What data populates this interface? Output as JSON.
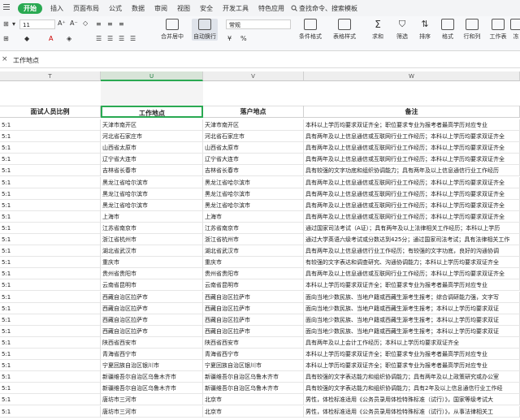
{
  "menubar": {
    "items": [
      "开始",
      "插入",
      "页面布局",
      "公式",
      "数据",
      "审阅",
      "视图",
      "安全",
      "开发工具",
      "特色应用"
    ],
    "search_label": "查找命令、搜索模板"
  },
  "ribbon": {
    "font_size": "11",
    "merge_label": "合并居中",
    "wrap_label": "自动换行",
    "number_format": "常规",
    "cond_format_label": "条件格式",
    "table_style_label": "表格样式",
    "sum_label": "求和",
    "filter_label": "筛选",
    "sort_label": "排序",
    "format_label": "格式",
    "rowcol_label": "行和列",
    "sheet_label": "工作表",
    "freeze_label": "冻"
  },
  "formula_bar": {
    "value": "工作地点"
  },
  "columns": [
    "T",
    "U",
    "V",
    "W"
  ],
  "header": [
    "面试人员比例",
    "工作地点",
    "落户地点",
    "备注"
  ],
  "rows": [
    [
      "5:1",
      "天津市南开区",
      "天津市南开区",
      "本科以上学历均要求双证齐全；职位要求专业为报考者最高学历对应专业"
    ],
    [
      "5:1",
      "河北省石家庄市",
      "河北省石家庄市",
      "具有两年及以上信息通信或互联网行业工作经历；本科以上学历均要求双证齐全"
    ],
    [
      "5:1",
      "山西省太原市",
      "山西省太原市",
      "具有两年及以上信息通信或互联网行业工作经历；本科以上学历均要求双证齐全"
    ],
    [
      "5:1",
      "辽宁省大连市",
      "辽宁省大连市",
      "具有两年及以上信息通信或互联网行业工作经历；本科以上学历均要求双证齐全"
    ],
    [
      "5:1",
      "吉林省长春市",
      "吉林省长春市",
      "具有较强的文字功底和组织协调能力；具有两年及以上信息通信行业工作经历"
    ],
    [
      "5:1",
      "黑龙江省哈尔滨市",
      "黑龙江省哈尔滨市",
      "具有两年及以上信息通信或互联网行业工作经历；本科以上学历均要求双证齐全"
    ],
    [
      "5:1",
      "黑龙江省哈尔滨市",
      "黑龙江省哈尔滨市",
      "具有两年及以上信息通信或互联网行业工作经历；本科以上学历均要求双证齐全"
    ],
    [
      "5:1",
      "黑龙江省哈尔滨市",
      "黑龙江省哈尔滨市",
      "具有两年及以上信息通信或互联网行业工作经历；本科以上学历均要求双证齐全"
    ],
    [
      "5:1",
      "上海市",
      "上海市",
      "具有两年及以上信息通信或互联网行业工作经历；本科以上学历均要求双证齐全"
    ],
    [
      "5:1",
      "江苏省南京市",
      "江苏省南京市",
      "通过国家司法考试（A证）；具有两年及以上法律相关工作经历；本科以上学历"
    ],
    [
      "5:1",
      "浙江省杭州市",
      "浙江省杭州市",
      "通过大学英语六级考试或分数达到425分；通过国家司法考试；具有法律相关工作"
    ],
    [
      "5:1",
      "湖北省武汉市",
      "湖北省武汉市",
      "具有两年及以上信息通信行业工作经历；有较强的文字功底，良好的沟通协调"
    ],
    [
      "5:1",
      "重庆市",
      "重庆市",
      "有较强的文字表达和调查研究、沟通协调能力；本科以上学历均要求双证齐全"
    ],
    [
      "5:1",
      "贵州省贵阳市",
      "贵州省贵阳市",
      "具有两年及以上信息通信或互联网行业工作经历；本科以上学历均要求双证齐全"
    ],
    [
      "5:1",
      "云南省昆明市",
      "云南省昆明市",
      "本科以上学历均要求双证齐全；职位要求专业为报考者最高学历对应专业"
    ],
    [
      "5:1",
      "西藏自治区拉萨市",
      "西藏自治区拉萨市",
      "面向当地少数民族、当地户籍或西藏生源考生报考；综合调研能力强，文字写"
    ],
    [
      "5:1",
      "西藏自治区拉萨市",
      "西藏自治区拉萨市",
      "面向当地少数民族、当地户籍或西藏生源考生报考；本科以上学历均要求双证"
    ],
    [
      "5:1",
      "西藏自治区拉萨市",
      "西藏自治区拉萨市",
      "面向当地少数民族、当地户籍或西藏生源考生报考；本科以上学历均要求双证"
    ],
    [
      "5:1",
      "西藏自治区拉萨市",
      "西藏自治区拉萨市",
      "面向当地少数民族、当地户籍或西藏生源考生报考；本科以上学历均要求双证"
    ],
    [
      "5:1",
      "陕西省西安市",
      "陕西省西安市",
      "具有两年及以上会计工作经历；本科以上学历均要求双证齐全"
    ],
    [
      "5:1",
      "青海省西宁市",
      "青海省西宁市",
      "本科以上学历均要求双证齐全；职位要求专业为报考者最高学历对应专业"
    ],
    [
      "5:1",
      "宁夏回族自治区银川市",
      "宁夏回族自治区银川市",
      "本科以上学历均要求双证齐全；职位要求专业为报考者最高学历对应专业"
    ],
    [
      "5:1",
      "新疆维吾尔自治区乌鲁木齐市",
      "新疆维吾尔自治区乌鲁木齐市",
      "具有较强的文字表达能力和组织协调能力；具有两年及以上政策研究或办公室"
    ],
    [
      "5:1",
      "新疆维吾尔自治区乌鲁木齐市",
      "新疆维吾尔自治区乌鲁木齐市",
      "具有较强的文字表达能力和组织协调能力；具有2年及以上信息通信行业工作经"
    ],
    [
      "5:1",
      "唐坊市三河市",
      "北京市",
      "男性，体检标准适用《公务员录用体检特殊标准（试行）》，国家等级考试大"
    ],
    [
      "5:1",
      "唐坊市三河市",
      "北京市",
      "男性，体检标准适用《公务员录用体检特殊标准（试行）》，从事法律相关工"
    ]
  ]
}
